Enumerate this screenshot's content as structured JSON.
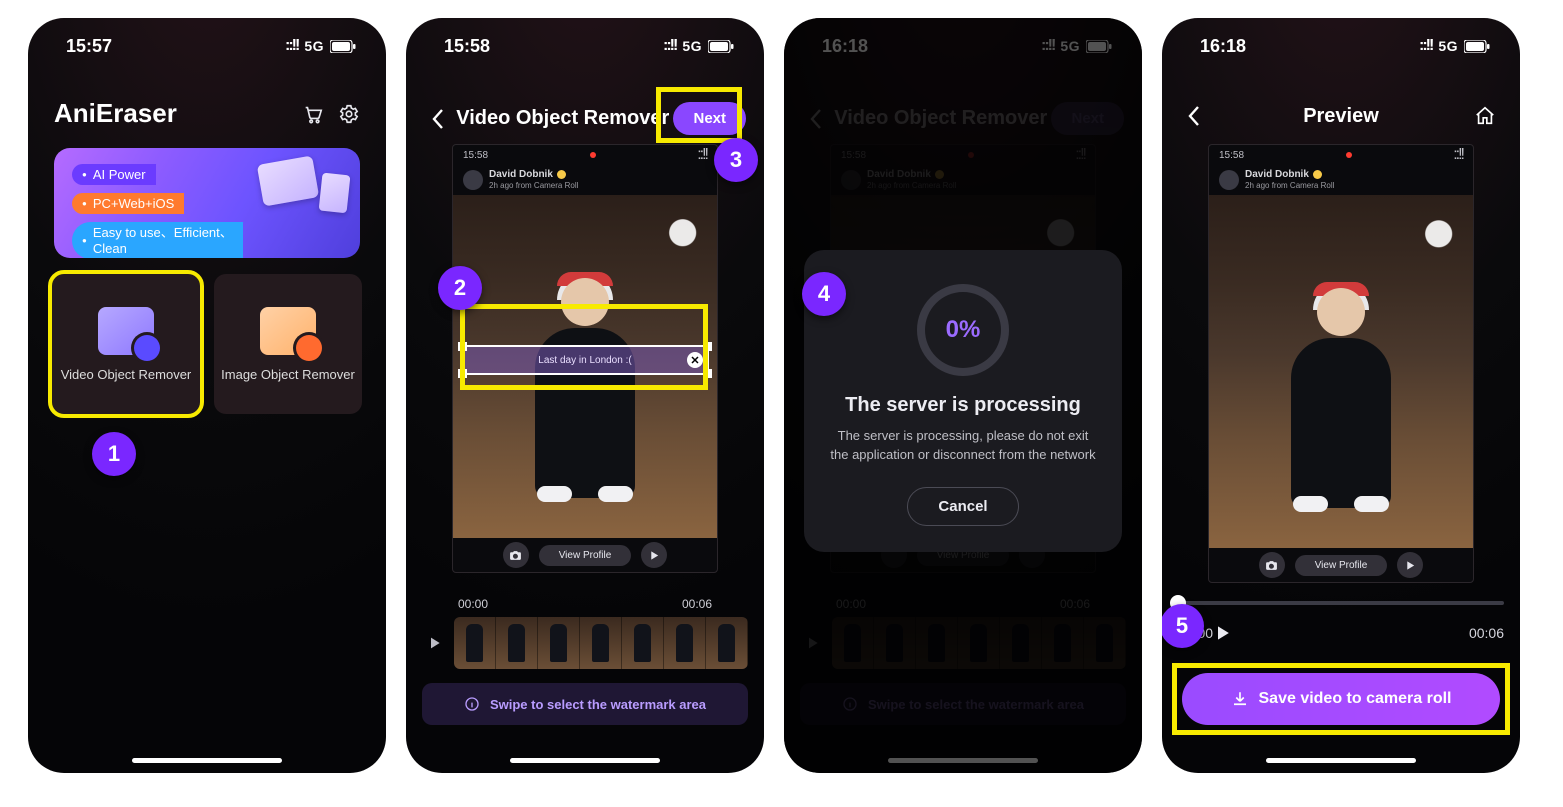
{
  "status": {
    "times": [
      "15:57",
      "15:58",
      "16:18",
      "16:18"
    ],
    "signal": "::!!",
    "net": "5G"
  },
  "screen1": {
    "app_title": "AniEraser",
    "promo": [
      "AI Power",
      "PC+Web+iOS",
      "Easy to use、Efficient、\nClean"
    ],
    "tile_video": "Video Object Remover",
    "tile_image": "Image Object Remover",
    "step": "1"
  },
  "screen2": {
    "title": "Video Object Remover",
    "next": "Next",
    "inner_time": "15:58",
    "poster": {
      "name": "David Dobnik",
      "sub": "2h ago from Camera Roll"
    },
    "watermark_text": "Last day in London :(",
    "view_profile": "View Profile",
    "time_start": "00:00",
    "time_end": "00:06",
    "hint": "Swipe to select the watermark area",
    "step_area": "2",
    "step_next": "3"
  },
  "screen3": {
    "title": "Video Object Remover",
    "next": "Next",
    "processing_pct": "0%",
    "processing_title": "The server is processing",
    "processing_body": "The server is processing, please do not exit the application or disconnect from the network",
    "cancel": "Cancel",
    "hint": "Swipe to select the watermark area",
    "time_start": "00:00",
    "time_end": "00:06",
    "step": "4"
  },
  "screen4": {
    "title": "Preview",
    "inner_time": "15:58",
    "poster": {
      "name": "David Dobnik",
      "sub": "2h ago from Camera Roll"
    },
    "view_profile": "View Profile",
    "time_start": "00:00",
    "time_end": "00:06",
    "save": "Save video to camera roll",
    "step": "5"
  }
}
